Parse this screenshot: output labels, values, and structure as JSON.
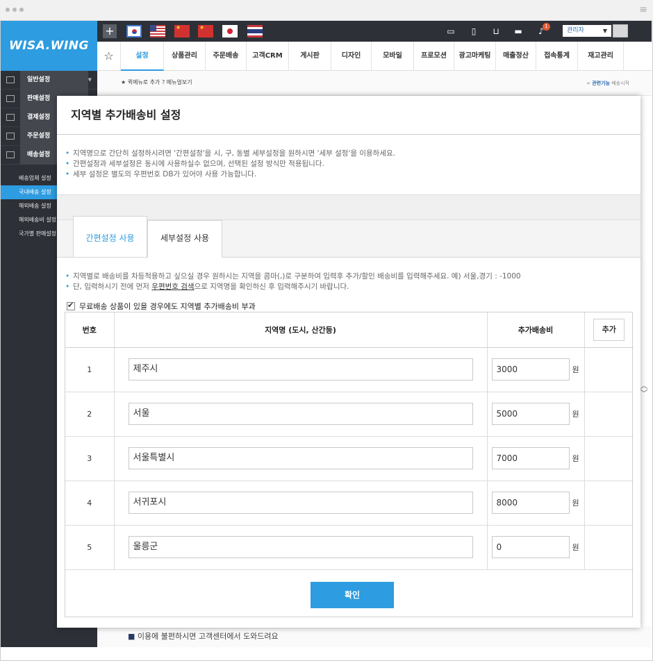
{
  "brand": {
    "logo": "WISA.WING"
  },
  "topbar": {
    "user_role": "관리자",
    "notification_count": "1",
    "flags": [
      "korea",
      "usa",
      "china",
      "china-2",
      "japan",
      "thailand"
    ],
    "icons": [
      "monitor-icon",
      "mobile-icon",
      "basket-icon",
      "chat-icon",
      "mic-icon"
    ]
  },
  "nav": {
    "tabs": [
      "설정",
      "상품관리",
      "주문배송",
      "고객CRM",
      "게시판",
      "디자인",
      "모바일",
      "프로모션",
      "광고마케팅",
      "매출정산",
      "접속통계",
      "재고관리"
    ],
    "active_index": 0
  },
  "quick_menu": {
    "add": "퀵메뉴로 추가",
    "view": "메뉴얼보기"
  },
  "related": {
    "label": "관련기능",
    "link": "배송시작"
  },
  "sidebar": {
    "items": [
      "일반설정",
      "판매설정",
      "결제설정",
      "주문설정",
      "배송설정"
    ],
    "sub_items": [
      "배송업체 설정",
      "국내배송 설정",
      "해외배송 설정",
      "해외배송비 설정",
      "국가별 판매설정"
    ],
    "active_sub": 1
  },
  "help_bar": {
    "text": "이용에 불편하시면 고객센터에서 도와드려요"
  },
  "modal": {
    "title": "지역별 추가배송비 설정",
    "desc": [
      "지역명으로 간단히 설정하시려면 '간편설정'을 시, 구, 동별 세부설정을 원하시면 '세부 설정'을 이용하세요.",
      "간편설정과 세부설정은 동시에 사용하실수 없으며, 선택된 설정 방식만 적용됩니다.",
      "세부 설정은 별도의 우편번호 DB가 있어야 사용 가능합니다."
    ],
    "tabs": [
      "간편설정 사용",
      "세부설정 사용"
    ],
    "desc2_1": "지역별로 배송비를 차등적용하고 싶으실 경우 원하시는 지역을 콤마(,)로 구분하여 입력후 추가/할인 배송비를 입력해주세요. 예) 서울,경기 : -1000",
    "desc2_2_pre": "단, 입력하시기 전에 먼저 ",
    "desc2_2_link": "우편번호 검색",
    "desc2_2_post": "으로 지역명을 확인하신 후 입력해주시기 바랍니다.",
    "checkbox_label": "무료배송 상품이 있을 경우에도 지역별 추가배송비 부과",
    "table": {
      "headers": {
        "num": "번호",
        "region": "지역명 (도시, 산간등)",
        "fee": "추가배송비",
        "add": "추가"
      },
      "unit": "원",
      "rows": [
        {
          "num": "1",
          "region": "제주시",
          "fee": "3000"
        },
        {
          "num": "2",
          "region": "서울",
          "fee": "5000"
        },
        {
          "num": "3",
          "region": "서울특별시",
          "fee": "7000"
        },
        {
          "num": "4",
          "region": "서귀포시",
          "fee": "8000"
        },
        {
          "num": "5",
          "region": "울릉군",
          "fee": "0"
        }
      ]
    },
    "confirm": "확인"
  }
}
